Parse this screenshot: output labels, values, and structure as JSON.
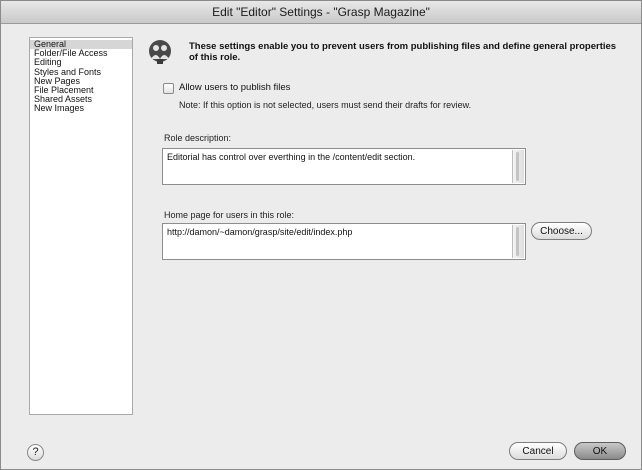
{
  "window": {
    "title": "Edit \"Editor\" Settings - \"Grasp Magazine\""
  },
  "sidebar": {
    "items": [
      {
        "label": "General",
        "selected": true
      },
      {
        "label": "Folder/File Access",
        "selected": false
      },
      {
        "label": "Editing",
        "selected": false
      },
      {
        "label": "Styles and Fonts",
        "selected": false
      },
      {
        "label": "New Pages",
        "selected": false
      },
      {
        "label": "File Placement",
        "selected": false
      },
      {
        "label": "Shared Assets",
        "selected": false
      },
      {
        "label": "New Images",
        "selected": false
      }
    ]
  },
  "main": {
    "info_text": "These settings enable you to prevent users from publishing files and define general properties of this role.",
    "publish_checkbox": {
      "label": "Allow users to publish files",
      "checked": false
    },
    "note": "Note: If this option is not selected, users must send their drafts for review.",
    "role_description": {
      "label": "Role description:",
      "value": "Editorial has control over everthing in the /content/edit section."
    },
    "home_page": {
      "label": "Home page for users in this role:",
      "value": "http://damon/~damon/grasp/site/edit/index.php",
      "choose_label": "Choose..."
    }
  },
  "footer": {
    "help_label": "?",
    "cancel_label": "Cancel",
    "ok_label": "OK"
  },
  "icons": {
    "info": "people-icon",
    "help": "help-icon"
  }
}
